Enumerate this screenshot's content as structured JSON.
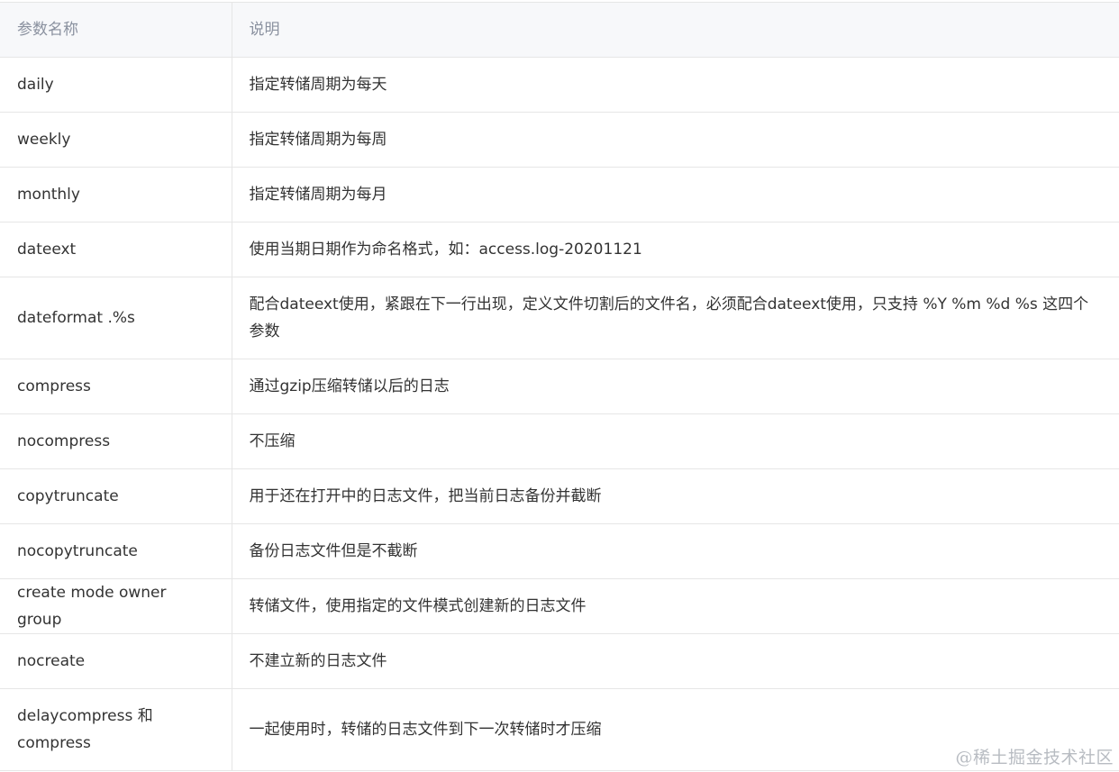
{
  "table": {
    "headers": [
      "参数名称",
      "说明"
    ],
    "rows": [
      {
        "param": "daily",
        "desc": "指定转储周期为每天"
      },
      {
        "param": "weekly",
        "desc": "指定转储周期为每周"
      },
      {
        "param": "monthly",
        "desc": "指定转储周期为每月"
      },
      {
        "param": "dateext",
        "desc": "使用当期日期作为命名格式，如：access.log-20201121"
      },
      {
        "param": "dateformat .%s",
        "desc": "配合dateext使用，紧跟在下一行出现，定义文件切割后的文件名，必须配合dateext使用，只支持 %Y %m %d %s 这四个参数"
      },
      {
        "param": "compress",
        "desc": "通过gzip压缩转储以后的日志"
      },
      {
        "param": "nocompress",
        "desc": "不压缩"
      },
      {
        "param": "copytruncate",
        "desc": "用于还在打开中的日志文件，把当前日志备份并截断"
      },
      {
        "param": "nocopytruncate",
        "desc": "备份日志文件但是不截断"
      },
      {
        "param": "create mode owner group",
        "desc": "转储文件，使用指定的文件模式创建新的日志文件"
      },
      {
        "param": "nocreate",
        "desc": "不建立新的日志文件"
      },
      {
        "param": "delaycompress 和 compress",
        "desc": "一起使用时，转储的日志文件到下一次转储时才压缩"
      }
    ]
  },
  "watermark": "@稀土掘金技术社区"
}
